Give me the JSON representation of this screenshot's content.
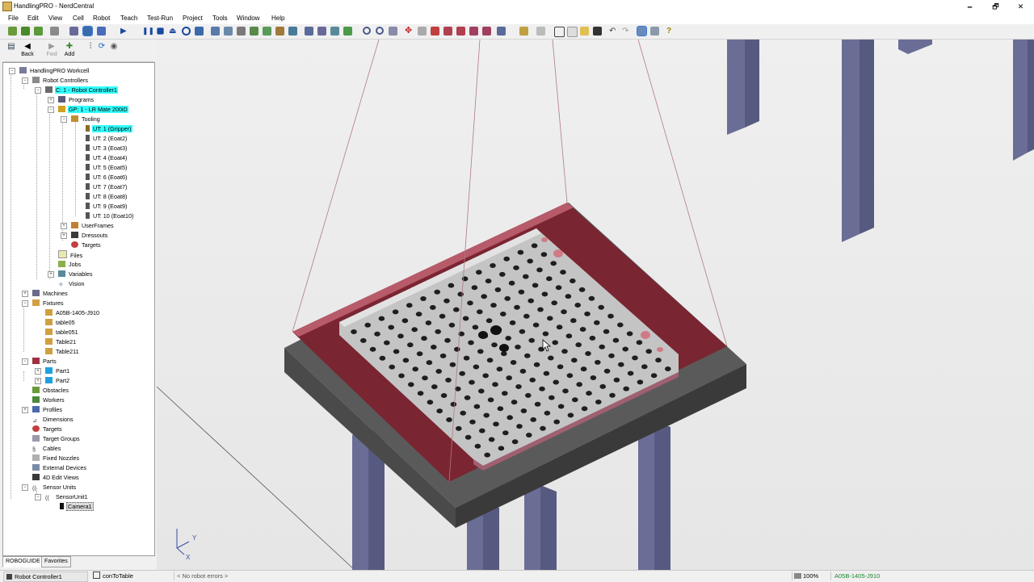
{
  "window": {
    "title": "HandlingPRO - NerdCentral",
    "min": "🗕",
    "max": "🗗",
    "close": "✕"
  },
  "menu": [
    "File",
    "Edit",
    "View",
    "Cell",
    "Robot",
    "Teach",
    "Test-Run",
    "Project",
    "Tools",
    "Window",
    "Help"
  ],
  "nav": {
    "back": "Back",
    "fwd": "Fwd",
    "add": "Add"
  },
  "tree": {
    "workcell": "HandlingPRO Workcell",
    "robot_controllers": "Robot Controllers",
    "controller": "C: 1 - Robot Controller1",
    "programs": "Programs",
    "group": "GP: 1 - LR Mate 200iD",
    "tooling": "Tooling",
    "tools": [
      "UT: 1  (Gripper)",
      "UT: 2  (Eoat2)",
      "UT: 3  (Eoat3)",
      "UT: 4  (Eoat4)",
      "UT: 5  (Eoat5)",
      "UT: 6  (Eoat6)",
      "UT: 7  (Eoat7)",
      "UT: 8  (Eoat8)",
      "UT: 9  (Eoat9)",
      "UT: 10  (Eoat10)"
    ],
    "userframes": "UserFrames",
    "dressouts": "Dressouts",
    "targets": "Targets",
    "files": "Files",
    "jobs": "Jobs",
    "variables": "Variables",
    "vision": "Vision",
    "machines": "Machines",
    "fixtures": "Fixtures",
    "fixture_items": [
      "A05B-1405-J910",
      "table05",
      "table051",
      "Table21",
      "Table211"
    ],
    "parts": "Parts",
    "part_items": [
      "Part1",
      "Part2"
    ],
    "obstacles": "Obstacles",
    "workers": "Workers",
    "profiles": "Profiles",
    "dimensions": "Dimensions",
    "targets2": "Targets",
    "target_groups": "Target Groups",
    "cables": "Cables",
    "fixed_nozzles": "Fixed Nozzles",
    "external_devices": "External Devices",
    "edit_views": "4D Edit Views",
    "sensor_units": "Sensor Units",
    "sensor_unit": "SensorUnit1",
    "camera": "Camera1"
  },
  "tabs": [
    "ROBOGUIDE",
    "Favorites"
  ],
  "axes": {
    "y": "Y",
    "x": "X"
  },
  "status": {
    "controller": "Robot Controller1",
    "program": "conToTable",
    "errors": "< No robot errors >",
    "zoom": "100%",
    "selection": "A05B-1405-J910"
  },
  "colors": {
    "highlight": "#33ffff",
    "fixture_red": "#7a2532",
    "plate": "#c4c4c4",
    "legs": "#6a6d96"
  }
}
